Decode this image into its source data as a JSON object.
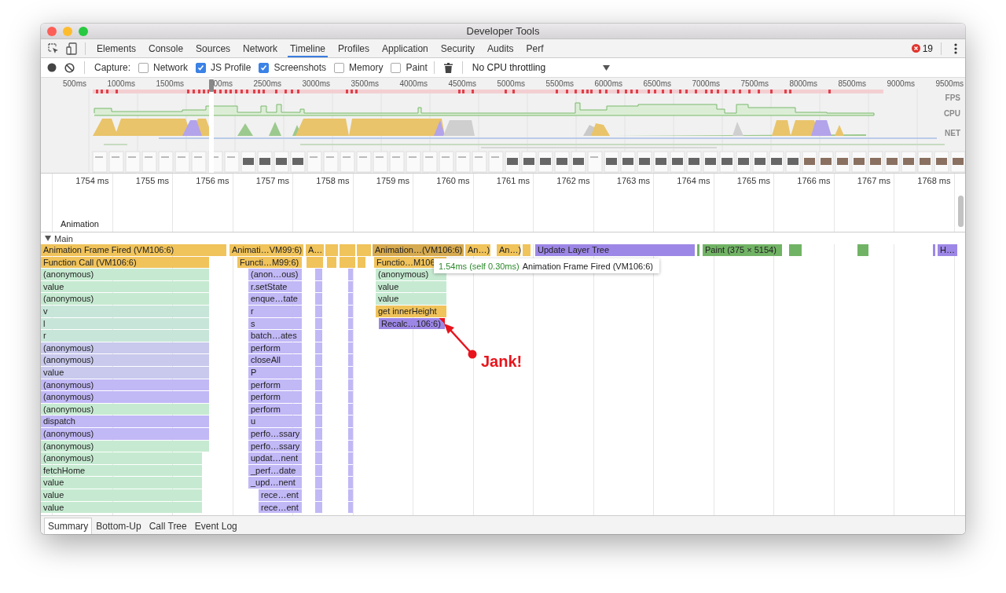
{
  "window": {
    "title": "Developer Tools"
  },
  "tabs": [
    {
      "label": "Elements",
      "selected": false
    },
    {
      "label": "Console",
      "selected": false
    },
    {
      "label": "Sources",
      "selected": false
    },
    {
      "label": "Network",
      "selected": false
    },
    {
      "label": "Timeline",
      "selected": true
    },
    {
      "label": "Profiles",
      "selected": false
    },
    {
      "label": "Application",
      "selected": false
    },
    {
      "label": "Security",
      "selected": false
    },
    {
      "label": "Audits",
      "selected": false
    },
    {
      "label": "Perf",
      "selected": false
    }
  ],
  "error_count": "19",
  "toolbar": {
    "capture_label": "Capture:",
    "options": [
      {
        "label": "Network",
        "checked": false
      },
      {
        "label": "JS Profile",
        "checked": true
      },
      {
        "label": "Screenshots",
        "checked": true
      },
      {
        "label": "Memory",
        "checked": false
      },
      {
        "label": "Paint",
        "checked": false
      }
    ],
    "throttling": "No CPU throttling"
  },
  "overview": {
    "ticks": [
      "500ms",
      "1000ms",
      "1500ms",
      "00ms",
      "2500ms",
      "3000ms",
      "3500ms",
      "4000ms",
      "4500ms",
      "5000ms",
      "5500ms",
      "6000ms",
      "6500ms",
      "7000ms",
      "7500ms",
      "8000ms",
      "8500ms",
      "9000ms",
      "9500ms"
    ],
    "track_labels": [
      "FPS",
      "CPU",
      "NET"
    ]
  },
  "ruler": {
    "ticks": [
      "1754 ms",
      "1755 ms",
      "1756 ms",
      "1757 ms",
      "1758 ms",
      "1759 ms",
      "1760 ms",
      "1761 ms",
      "1762 ms",
      "1763 ms",
      "1764 ms",
      "1765 ms",
      "1766 ms",
      "1767 ms",
      "1768 ms"
    ],
    "track_label": "Animation"
  },
  "main_track": {
    "label": "Main",
    "expanded": true
  },
  "flame_chart": {
    "stacks": [
      {
        "frames": [
          {
            "label": "Animation Frame Fired (VM106:6)",
            "color": "#f0c35b"
          },
          {
            "label": "Function Call (VM106:6)",
            "color": "#f0c35b"
          },
          {
            "label": "(anonymous)",
            "color": "#c6ead1"
          },
          {
            "label": "value",
            "color": "#c6ead1"
          },
          {
            "label": "(anonymous)",
            "color": "#c6ead1"
          },
          {
            "label": "v",
            "color": "#c7e6d9"
          },
          {
            "label": "l",
            "color": "#c7e6d9"
          },
          {
            "label": "r",
            "color": "#c7e6d9"
          },
          {
            "label": "(anonymous)",
            "color": "#c8c9ec"
          },
          {
            "label": "(anonymous)",
            "color": "#c8c9ec"
          },
          {
            "label": "value",
            "color": "#c8c9ec"
          },
          {
            "label": "(anonymous)",
            "color": "#c1b8f6"
          },
          {
            "label": "(anonymous)",
            "color": "#c1b8f6"
          },
          {
            "label": "(anonymous)",
            "color": "#c6ead1"
          },
          {
            "label": "dispatch",
            "color": "#c1b8f6"
          },
          {
            "label": "(anonymous)",
            "color": "#c1b8f6"
          },
          {
            "label": "(anonymous)",
            "color": "#c6ead1"
          },
          {
            "label": "(anonymous)",
            "color": "#c6ead1"
          },
          {
            "label": "fetchHome",
            "color": "#c6ead1"
          },
          {
            "label": "value",
            "color": "#c6ead1"
          },
          {
            "label": "value",
            "color": "#c6ead1"
          },
          {
            "label": "value",
            "color": "#c6ead1"
          }
        ]
      },
      {
        "frames": [
          {
            "label": "Animati…VM99:6)",
            "color": "#f0c35b"
          },
          {
            "label": "Functi…M99:6)",
            "color": "#f0c35b"
          },
          {
            "label": "(anon…ous)",
            "color": "#c1b8f6"
          },
          {
            "label": "r.setState",
            "color": "#c1b8f6"
          },
          {
            "label": "enque…tate",
            "color": "#c1b8f6"
          },
          {
            "label": "r",
            "color": "#c1b8f6"
          },
          {
            "label": "s",
            "color": "#c1b8f6"
          },
          {
            "label": "batch…ates",
            "color": "#c1b8f6"
          },
          {
            "label": "perform",
            "color": "#c1b8f6"
          },
          {
            "label": "closeAll",
            "color": "#c1b8f6"
          },
          {
            "label": "P",
            "color": "#c1b8f6"
          },
          {
            "label": "perform",
            "color": "#c1b8f6"
          },
          {
            "label": "perform",
            "color": "#c1b8f6"
          },
          {
            "label": "perform",
            "color": "#c1b8f6"
          },
          {
            "label": "u",
            "color": "#c1b8f6"
          },
          {
            "label": "perfo…ssary",
            "color": "#c1b8f6"
          },
          {
            "label": "perfo…ssary",
            "color": "#c1b8f6"
          },
          {
            "label": "updat…nent",
            "color": "#c1b8f6"
          },
          {
            "label": "_perf…date",
            "color": "#c1b8f6"
          },
          {
            "label": "_upd…nent",
            "color": "#c1b8f6"
          },
          {
            "label": "rece…ent",
            "color": "#c1b8f6"
          },
          {
            "label": "rece…ent",
            "color": "#c1b8f6"
          }
        ]
      },
      {
        "frames": [
          {
            "label": "A…",
            "color": "#f0c35b"
          },
          {
            "color": "#f0c35b"
          },
          {
            "color": "#c1b8f6"
          },
          {
            "color": "#c1b8f6"
          },
          {
            "color": "#c1b8f6"
          },
          {
            "color": "#c1b8f6"
          },
          {
            "color": "#c1b8f6"
          },
          {
            "color": "#c1b8f6"
          },
          {
            "color": "#c1b8f6"
          },
          {
            "color": "#c1b8f6"
          },
          {
            "color": "#c1b8f6"
          },
          {
            "color": "#c1b8f6"
          },
          {
            "color": "#c1b8f6"
          },
          {
            "color": "#c1b8f6"
          },
          {
            "color": "#c1b8f6"
          },
          {
            "color": "#c1b8f6"
          },
          {
            "color": "#c1b8f6"
          },
          {
            "color": "#c1b8f6"
          },
          {
            "color": "#c1b8f6"
          },
          {
            "color": "#c1b8f6"
          },
          {
            "color": "#c1b8f6"
          },
          {
            "color": "#c1b8f6"
          }
        ]
      },
      {
        "frames": [
          {
            "color": "#f0c35b"
          },
          {
            "color": "#f0c35b"
          }
        ]
      },
      {
        "frames": [
          {
            "color": "#f0c35b"
          },
          {
            "color": "#f0c35b"
          },
          {
            "color": "#c1b8f6"
          },
          {
            "color": "#c1b8f6"
          },
          {
            "color": "#c1b8f6"
          },
          {
            "color": "#c1b8f6"
          },
          {
            "color": "#c1b8f6"
          },
          {
            "color": "#c1b8f6"
          },
          {
            "color": "#c1b8f6"
          },
          {
            "color": "#c1b8f6"
          },
          {
            "color": "#c1b8f6"
          },
          {
            "color": "#c1b8f6"
          },
          {
            "color": "#c1b8f6"
          },
          {
            "color": "#c1b8f6"
          },
          {
            "color": "#c1b8f6"
          },
          {
            "color": "#c1b8f6"
          },
          {
            "color": "#c1b8f6"
          },
          {
            "color": "#c1b8f6"
          },
          {
            "color": "#c1b8f6"
          },
          {
            "color": "#c1b8f6"
          },
          {
            "color": "#c1b8f6"
          },
          {
            "color": "#c1b8f6"
          }
        ]
      },
      {
        "frames": [
          {
            "color": "#f0c35b"
          },
          {
            "color": "#f0c35b"
          }
        ]
      },
      {
        "frames": [
          {
            "label": "Animation…(VM106:6)",
            "color": "#d6aa50"
          },
          {
            "label": "Functio…M106",
            "color": "#f0c35b"
          },
          {
            "label": "(anonymous)",
            "color": "#c6ead1"
          },
          {
            "label": "value",
            "color": "#c6ead1"
          },
          {
            "label": "value",
            "color": "#c6ead1"
          },
          {
            "label": "get innerHeight",
            "color": "#f0c35b"
          },
          {
            "label": "Recalc…106:6)",
            "color": "#9d87e6",
            "warning": true
          }
        ]
      },
      {
        "frames": [
          {
            "label": "An…)",
            "color": "#f0c35b"
          }
        ]
      },
      {
        "frames": [
          {
            "label": "An…)",
            "color": "#f0c35b"
          }
        ]
      },
      {
        "frames": [
          {
            "color": "#f0c35b"
          }
        ]
      },
      {
        "frames": [
          {
            "label": "Update Layer Tree",
            "color": "#9d87e6"
          }
        ]
      },
      {
        "frames": [
          {
            "color": "#71b365"
          }
        ]
      },
      {
        "frames": [
          {
            "label": "Paint (375 × 5154)",
            "color": "#71b365"
          }
        ]
      },
      {
        "frames": [
          {
            "color": "#71b365"
          }
        ]
      },
      {
        "frames": [
          {
            "color": "#71b365"
          }
        ]
      },
      {
        "frames": [
          {
            "color": "#9d87e6"
          }
        ]
      },
      {
        "frames": [
          {
            "label": "H…",
            "color": "#9d87e6"
          }
        ]
      }
    ]
  },
  "tooltip": {
    "duration": "1.54ms (self 0.30ms)",
    "event": "Animation Frame Fired (VM106:6)"
  },
  "annotation": {
    "text": "Jank!"
  },
  "bottom_tabs": [
    {
      "label": "Summary",
      "selected": true
    },
    {
      "label": "Bottom-Up",
      "selected": false
    },
    {
      "label": "Call Tree",
      "selected": false
    },
    {
      "label": "Event Log",
      "selected": false
    }
  ]
}
